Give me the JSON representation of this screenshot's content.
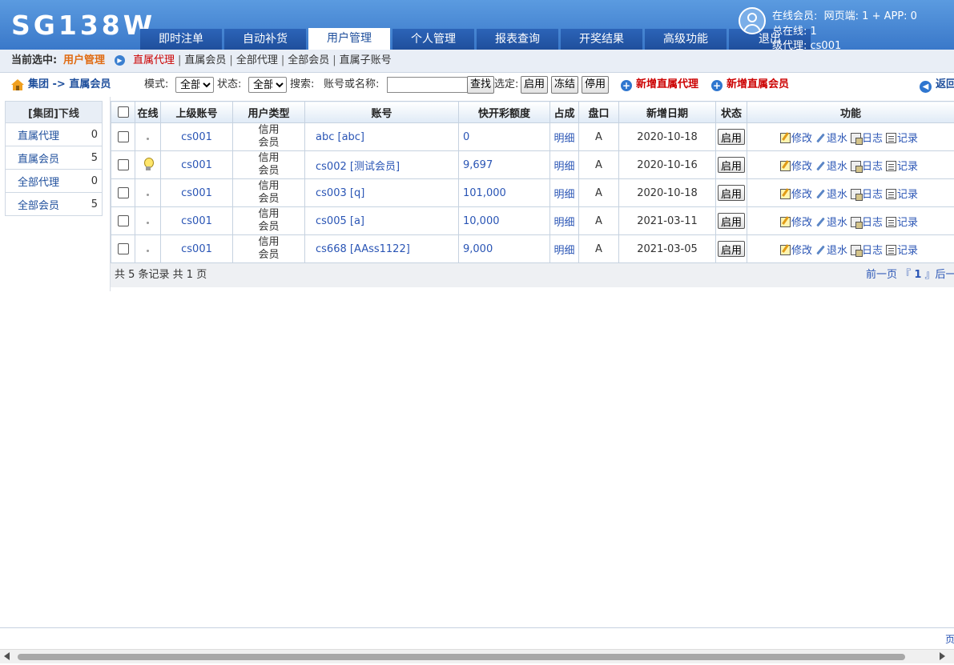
{
  "header": {
    "logo": "SG138W",
    "tabs": [
      "即时注单",
      "自动补货",
      "用户管理",
      "个人管理",
      "报表查询",
      "开奖结果",
      "高级功能",
      "退出"
    ],
    "active_tab": "用户管理",
    "online_label": "在线会员:",
    "online_value": "网页端: 1 + APP: 0",
    "total_online": "总在线: 1",
    "agent_line": "级代理: cs001"
  },
  "subbar": {
    "label": "当前选中:",
    "current": "用户管理",
    "links": [
      "直属代理",
      "直属会员",
      "全部代理",
      "全部会员",
      "直属子账号"
    ],
    "active_link": "直属代理"
  },
  "toolbar": {
    "crumb": "集团 -> 直属会员",
    "mode_label": "模式:",
    "mode_value": "全部",
    "status_label": "状态:",
    "status_value": "全部",
    "search_label": "搜索:",
    "search_hint": "账号或名称:",
    "search_value": "",
    "search_btn": "查找",
    "select_label": "选定:",
    "btn_enable": "启用",
    "btn_freeze": "冻结",
    "btn_disable": "停用",
    "add_agent": "新增直属代理",
    "add_member": "新增直属会员",
    "back": "返回"
  },
  "sidebar": {
    "title": "[集团]下线",
    "items": [
      {
        "label": "直属代理",
        "count": "0"
      },
      {
        "label": "直属会员",
        "count": "5"
      },
      {
        "label": "全部代理",
        "count": "0"
      },
      {
        "label": "全部会员",
        "count": "5"
      }
    ]
  },
  "table": {
    "headers": [
      "在线",
      "上级账号",
      "用户类型",
      "账号",
      "快开彩额度",
      "占成",
      "盘口",
      "新增日期",
      "状态",
      "功能"
    ],
    "rows": [
      {
        "online": "dot",
        "parent": "cs001",
        "type1": "信用",
        "type2": "会员",
        "account": "abc [abc]",
        "limit": "0",
        "share": "明细",
        "handicap": "A",
        "date": "2020-10-18",
        "status": "启用"
      },
      {
        "online": "bulb",
        "parent": "cs001",
        "type1": "信用",
        "type2": "会员",
        "account": "cs002 [测试会员]",
        "limit": "9,697",
        "share": "明细",
        "handicap": "A",
        "date": "2020-10-16",
        "status": "启用"
      },
      {
        "online": "dot",
        "parent": "cs001",
        "type1": "信用",
        "type2": "会员",
        "account": "cs003 [q]",
        "limit": "101,000",
        "share": "明细",
        "handicap": "A",
        "date": "2020-10-18",
        "status": "启用"
      },
      {
        "online": "dot",
        "parent": "cs001",
        "type1": "信用",
        "type2": "会员",
        "account": "cs005 [a]",
        "limit": "10,000",
        "share": "明细",
        "handicap": "A",
        "date": "2021-03-11",
        "status": "启用"
      },
      {
        "online": "dot",
        "parent": "cs001",
        "type1": "信用",
        "type2": "会员",
        "account": "cs668 [AAss1122]",
        "limit": "9,000",
        "share": "明细",
        "handicap": "A",
        "date": "2021-03-05",
        "status": "启用"
      }
    ],
    "func_labels": {
      "edit": "修改",
      "rebate": "退水",
      "log": "日志",
      "record": "记录"
    }
  },
  "pager": {
    "summary": "共 5 条记录 共 1 页",
    "prev": "前一页",
    "lbr": "『",
    "page": "1",
    "rbr": "』",
    "next": "后一页"
  },
  "footer": {
    "corner": "页"
  }
}
